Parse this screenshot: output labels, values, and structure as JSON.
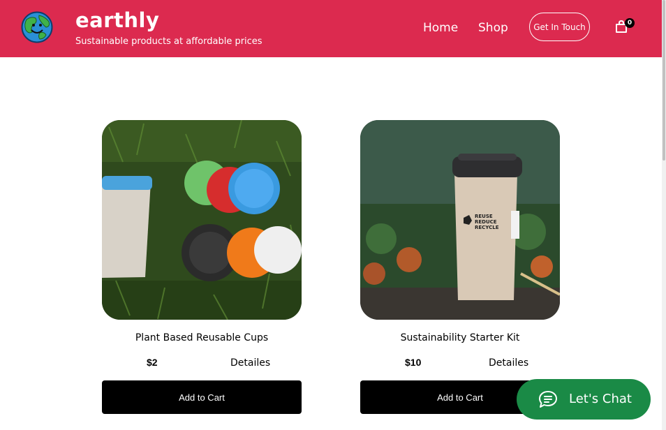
{
  "header": {
    "brand_name": "earthly",
    "tagline": "Sustainable products at affordable prices",
    "nav": {
      "home": "Home",
      "shop": "Shop"
    },
    "contact_label": "Get In Touch",
    "cart_count": "0",
    "background_color": "#dc2a4f"
  },
  "products": [
    {
      "title": "Plant Based Reusable Cups",
      "price": "$2",
      "details_label": "Detailes",
      "add_to_cart_label": "Add to Cart"
    },
    {
      "title": "Sustainability Starter Kit",
      "price": "$10",
      "details_label": "Detailes",
      "add_to_cart_label": "Add to Cart"
    }
  ],
  "chat": {
    "label": "Let's Chat",
    "color": "#1a8a46"
  },
  "icons": {
    "logo": "earth-smiley-icon",
    "cart": "shopping-bag-icon",
    "chat": "chat-bubble-icon"
  }
}
